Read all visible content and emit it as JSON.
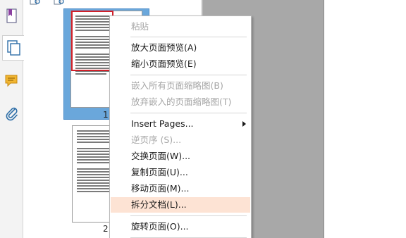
{
  "context_menu": {
    "items": [
      {
        "label": "粘贴",
        "enabled": false
      },
      {
        "label": "放大页面预览(A)",
        "enabled": true
      },
      {
        "label": "缩小页面预览(E)",
        "enabled": true
      },
      {
        "label": "嵌入所有页面缩略图(B)",
        "enabled": false
      },
      {
        "label": "放弃嵌入的页面缩略图(T)",
        "enabled": false
      },
      {
        "label": "Insert Pages...",
        "enabled": true,
        "submenu": true
      },
      {
        "label": "逆页序 (S)...",
        "enabled": false
      },
      {
        "label": "交换页面(W)...",
        "enabled": true
      },
      {
        "label": "复制页面(U)...",
        "enabled": true
      },
      {
        "label": "移动页面(M)...",
        "enabled": true
      },
      {
        "label": "拆分文档(L)...",
        "enabled": true,
        "hovered": true
      },
      {
        "label": "旋转页面(O)...",
        "enabled": true
      }
    ]
  },
  "thumbnails": {
    "pages": [
      {
        "number": "1",
        "selected": true
      },
      {
        "number": "2",
        "selected": false
      }
    ]
  },
  "icons": {
    "rail": [
      "bookmark-icon",
      "page-thumbnails-icon",
      "comment-icon",
      "attachment-icon"
    ],
    "toolbar": [
      "zoom-out-thumbnails-icon",
      "zoom-in-thumbnails-icon"
    ]
  },
  "colors": {
    "selection": "#6aa7db",
    "hover": "#fde3d4",
    "viewport_rect": "#d0202a"
  }
}
